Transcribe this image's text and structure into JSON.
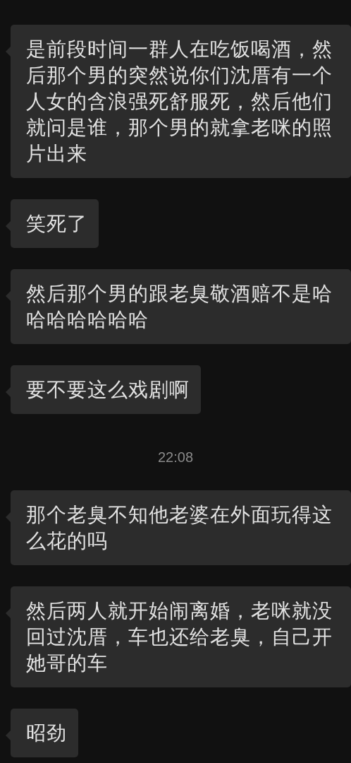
{
  "messages": [
    {
      "kind": "message",
      "text": "是前段时间一群人在吃饭喝酒，然后那个男的突然说你们沈厝有一个人女的含浪强死舒服死，然后他们就问是谁，那个男的就拿老咪的照片出来"
    },
    {
      "kind": "message",
      "text": "笑死了"
    },
    {
      "kind": "message",
      "text": "然后那个男的跟老臭敬酒赔不是哈哈哈哈哈哈哈"
    },
    {
      "kind": "message",
      "text": "要不要这么戏剧啊"
    },
    {
      "kind": "time",
      "text": "22:08"
    },
    {
      "kind": "message",
      "text": "那个老臭不知他老婆在外面玩得这么花的吗"
    },
    {
      "kind": "message",
      "text": "然后两人就开始闹离婚，老咪就没回过沈厝，车也还给老臭，自己开她哥的车"
    },
    {
      "kind": "message",
      "text": "昭劲"
    }
  ]
}
